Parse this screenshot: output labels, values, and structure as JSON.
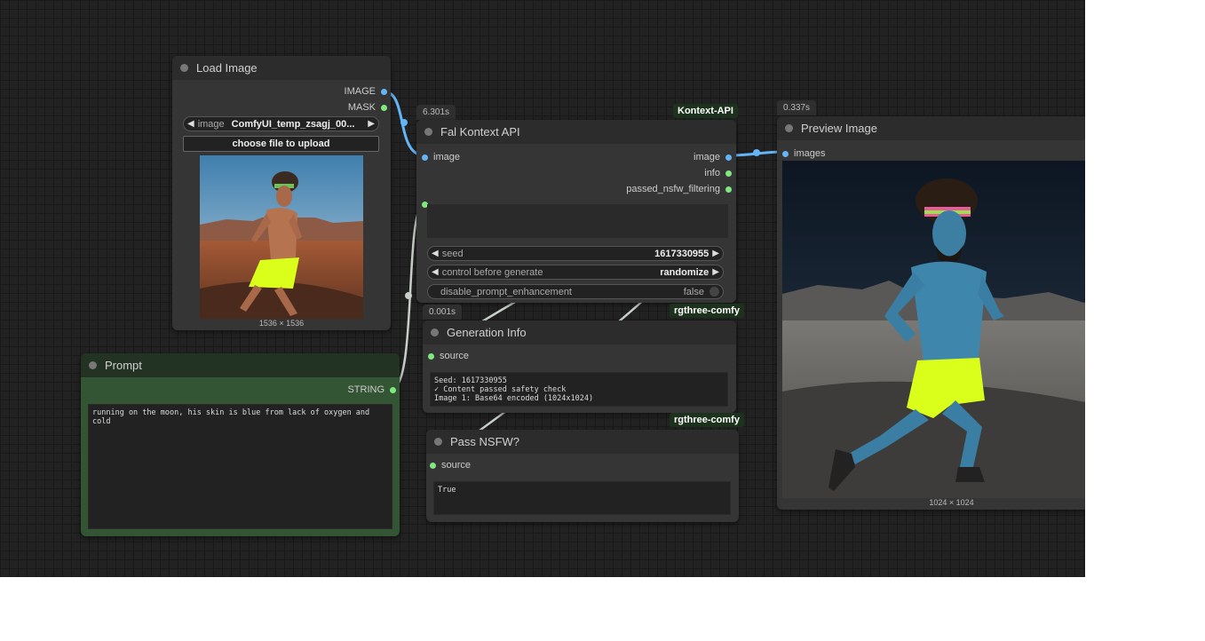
{
  "load_image": {
    "title": "Load Image",
    "outputs": [
      "IMAGE",
      "MASK"
    ],
    "image_widget": {
      "label": "image",
      "value": "ComfyUI_temp_zsagj_00..."
    },
    "upload_label": "choose file to upload",
    "dims": "1536 × 1536"
  },
  "fal_kontext": {
    "title": "Fal Kontext API",
    "timing": "6.301s",
    "tag": "Kontext-API",
    "input": "image",
    "outputs": [
      "image",
      "info",
      "passed_nsfw_filtering"
    ],
    "seed": {
      "label": "seed",
      "value": "1617330955"
    },
    "control": {
      "label": "control before generate",
      "value": "randomize"
    },
    "toggle": {
      "label": "disable_prompt_enhancement",
      "value": "false"
    }
  },
  "preview_image": {
    "title": "Preview Image",
    "timing": "0.337s",
    "input": "images",
    "dims": "1024 × 1024"
  },
  "prompt": {
    "title": "Prompt",
    "output": "STRING",
    "text": "running on the moon, his skin is blue from lack of oxygen and cold"
  },
  "generation_info": {
    "title": "Generation Info",
    "timing": "0.001s",
    "tag": "rgthree-comfy",
    "input": "source",
    "text": "Seed: 1617330955\n✓ Content passed safety check\nImage 1: Base64 encoded (1024x1024)"
  },
  "pass_nsfw": {
    "title": "Pass NSFW?",
    "tag": "rgthree-comfy",
    "input": "source",
    "text": "True"
  },
  "colors": {
    "image_link": "#64b5f6",
    "string_link": "#7fe87f",
    "generic_link": "#c8cfc8"
  }
}
